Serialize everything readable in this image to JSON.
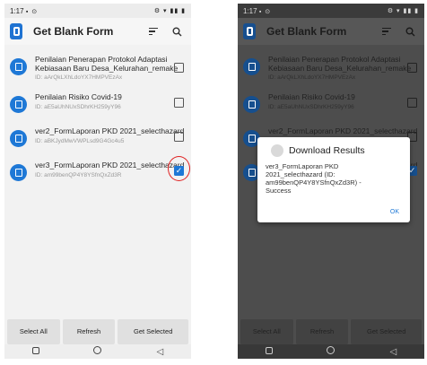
{
  "status": {
    "time": "1:17",
    "left_icons": "▪ ⊙",
    "right_icons": "⚙ ▾ ▮▮ ▮"
  },
  "app": {
    "title": "Get Blank Form",
    "sort_icon": "sort-icon",
    "search_icon": "search-icon"
  },
  "forms": [
    {
      "name": "Penilaian Penerapan Protokol Adaptasi Kebiasaan Baru Desa_Kelurahan_remake",
      "id": "ID: aArQkLXhLdoYX7HMPVEzAx",
      "checked": false
    },
    {
      "name": "Penilaian Risiko Covid-19",
      "id": "ID: aE5aUhNUxSDhrKH259yY96",
      "checked": false
    },
    {
      "name": "ver2_FormLaporan PKD 2021_selecthazard",
      "id": "ID: aBKJydMwVWPLsd9G4Gc4u5",
      "checked": false
    },
    {
      "name": "ver3_FormLaporan PKD 2021_selecthazard",
      "id": "ID: am99benQP4Y8YSfnQxZd3R",
      "checked": true
    }
  ],
  "buttons": {
    "select_all": "Select All",
    "refresh": "Refresh",
    "get_selected": "Get Selected"
  },
  "checkmark": "✓",
  "nav": {
    "back": "◁"
  },
  "dialog": {
    "title": "Download Results",
    "message": "ver3_FormLaporan PKD 2021_selecthazard (ID: am99benQP4Y8YSfnQxZd3R) - Success",
    "ok": "OK"
  },
  "colors": {
    "accent": "#1e78d6",
    "highlight": "#e02020",
    "overlay": "#4d4d4d"
  }
}
